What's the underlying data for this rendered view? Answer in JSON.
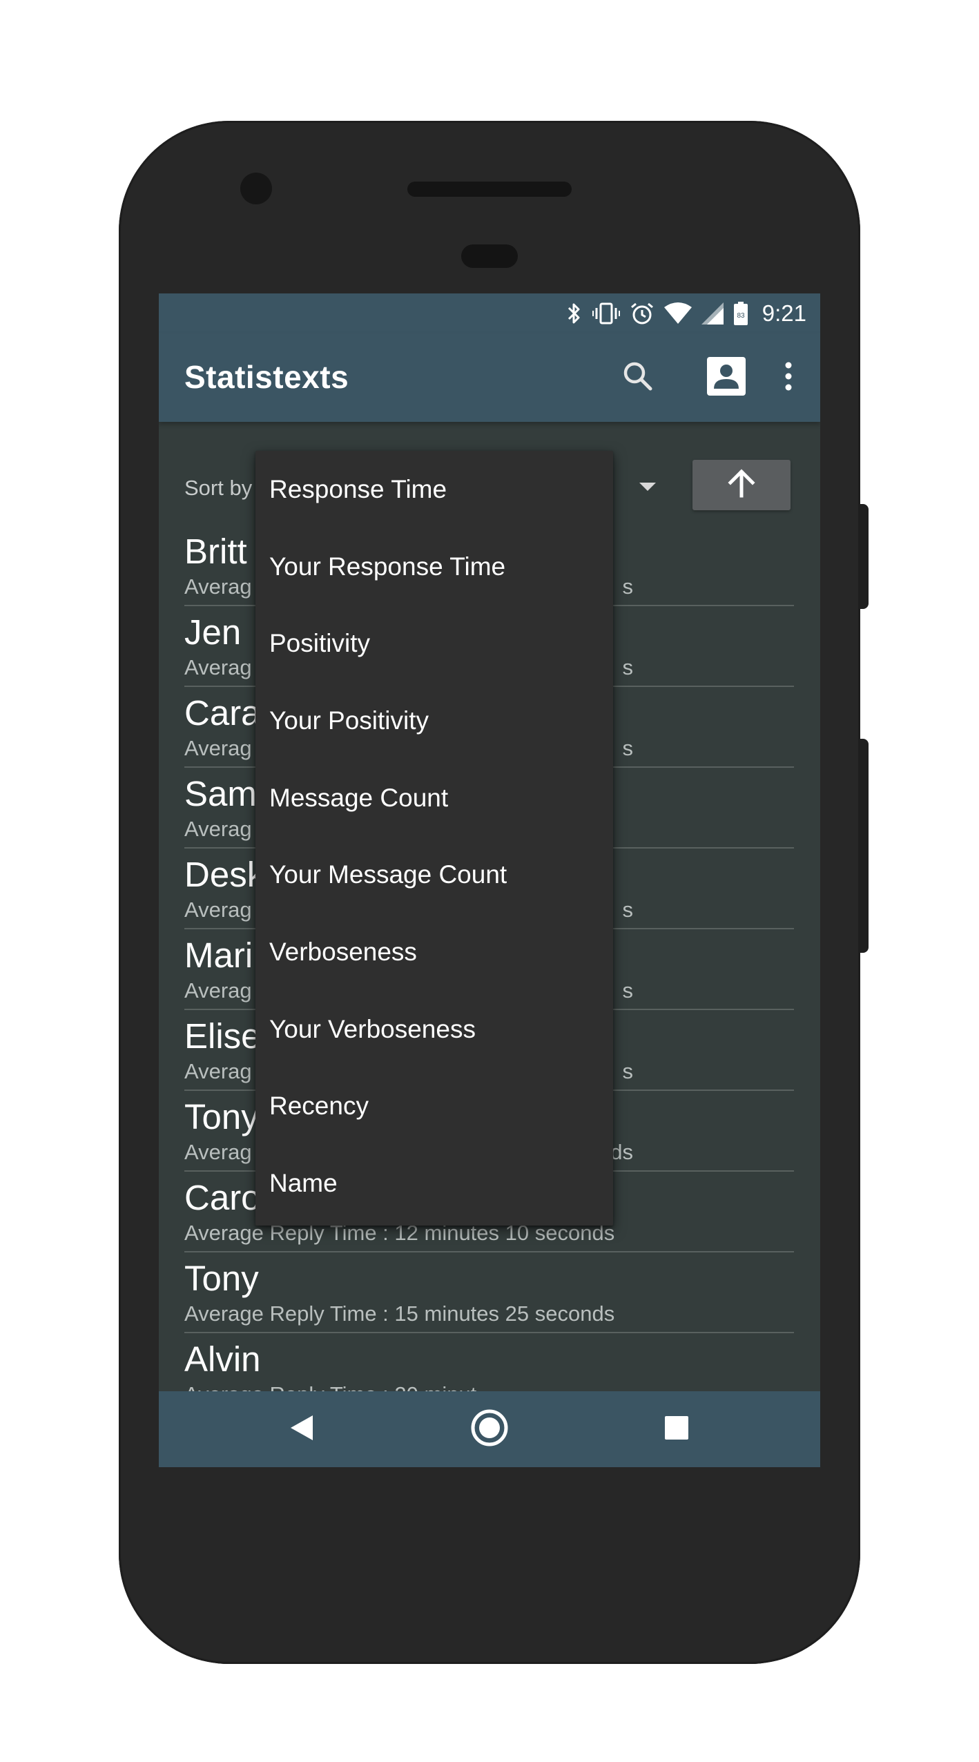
{
  "status_bar": {
    "time": "9:21",
    "battery_level": "83",
    "icons": [
      "bluetooth-icon",
      "vibrate-icon",
      "alarm-icon",
      "wifi-icon",
      "signal-icon",
      "battery-icon"
    ]
  },
  "app_bar": {
    "title": "Statistexts",
    "actions": [
      "search-icon",
      "contact-icon",
      "more-vert-icon"
    ]
  },
  "sort": {
    "label": "Sort by",
    "order_icon": "arrow-up-icon"
  },
  "dropdown": {
    "options": [
      "Response Time",
      "Your Response Time",
      "Positivity",
      "Your Positivity",
      "Message Count",
      "Your Message Count",
      "Verboseness",
      "Your Verboseness",
      "Recency",
      "Name"
    ]
  },
  "contacts": [
    {
      "name": "Britt",
      "stat": "Averag",
      "stat_tail": "s"
    },
    {
      "name": "Jen",
      "stat": "Averag",
      "stat_tail": "s"
    },
    {
      "name": "Cara",
      "stat": "Averag",
      "stat_tail": "s"
    },
    {
      "name": "Sam",
      "stat": "Averag",
      "stat_tail": ""
    },
    {
      "name": "Desk",
      "stat": "Averag",
      "stat_tail": "s"
    },
    {
      "name": "Mari",
      "stat": "Averag",
      "stat_tail": "s"
    },
    {
      "name": "Elise",
      "stat": "Averag",
      "stat_tail": "s"
    },
    {
      "name": "Tony",
      "stat": "Averag",
      "stat_tail": "ds"
    },
    {
      "name": "Caro",
      "stat": "Average Reply Time : 12 minutes 10 seconds",
      "stat_tail": ""
    },
    {
      "name": "Tony",
      "stat": "Average Reply Time : 15 minutes 25 seconds",
      "stat_tail": ""
    },
    {
      "name": "Alvin",
      "stat": "Average Reply Time : 20 minut",
      "stat_tail": ""
    }
  ],
  "nav_bar": {
    "buttons": [
      "back-icon",
      "home-icon",
      "recents-icon"
    ]
  },
  "colors": {
    "app_bar": "#3b5563",
    "background": "#343d3c",
    "menu": "#2f2f2f"
  }
}
